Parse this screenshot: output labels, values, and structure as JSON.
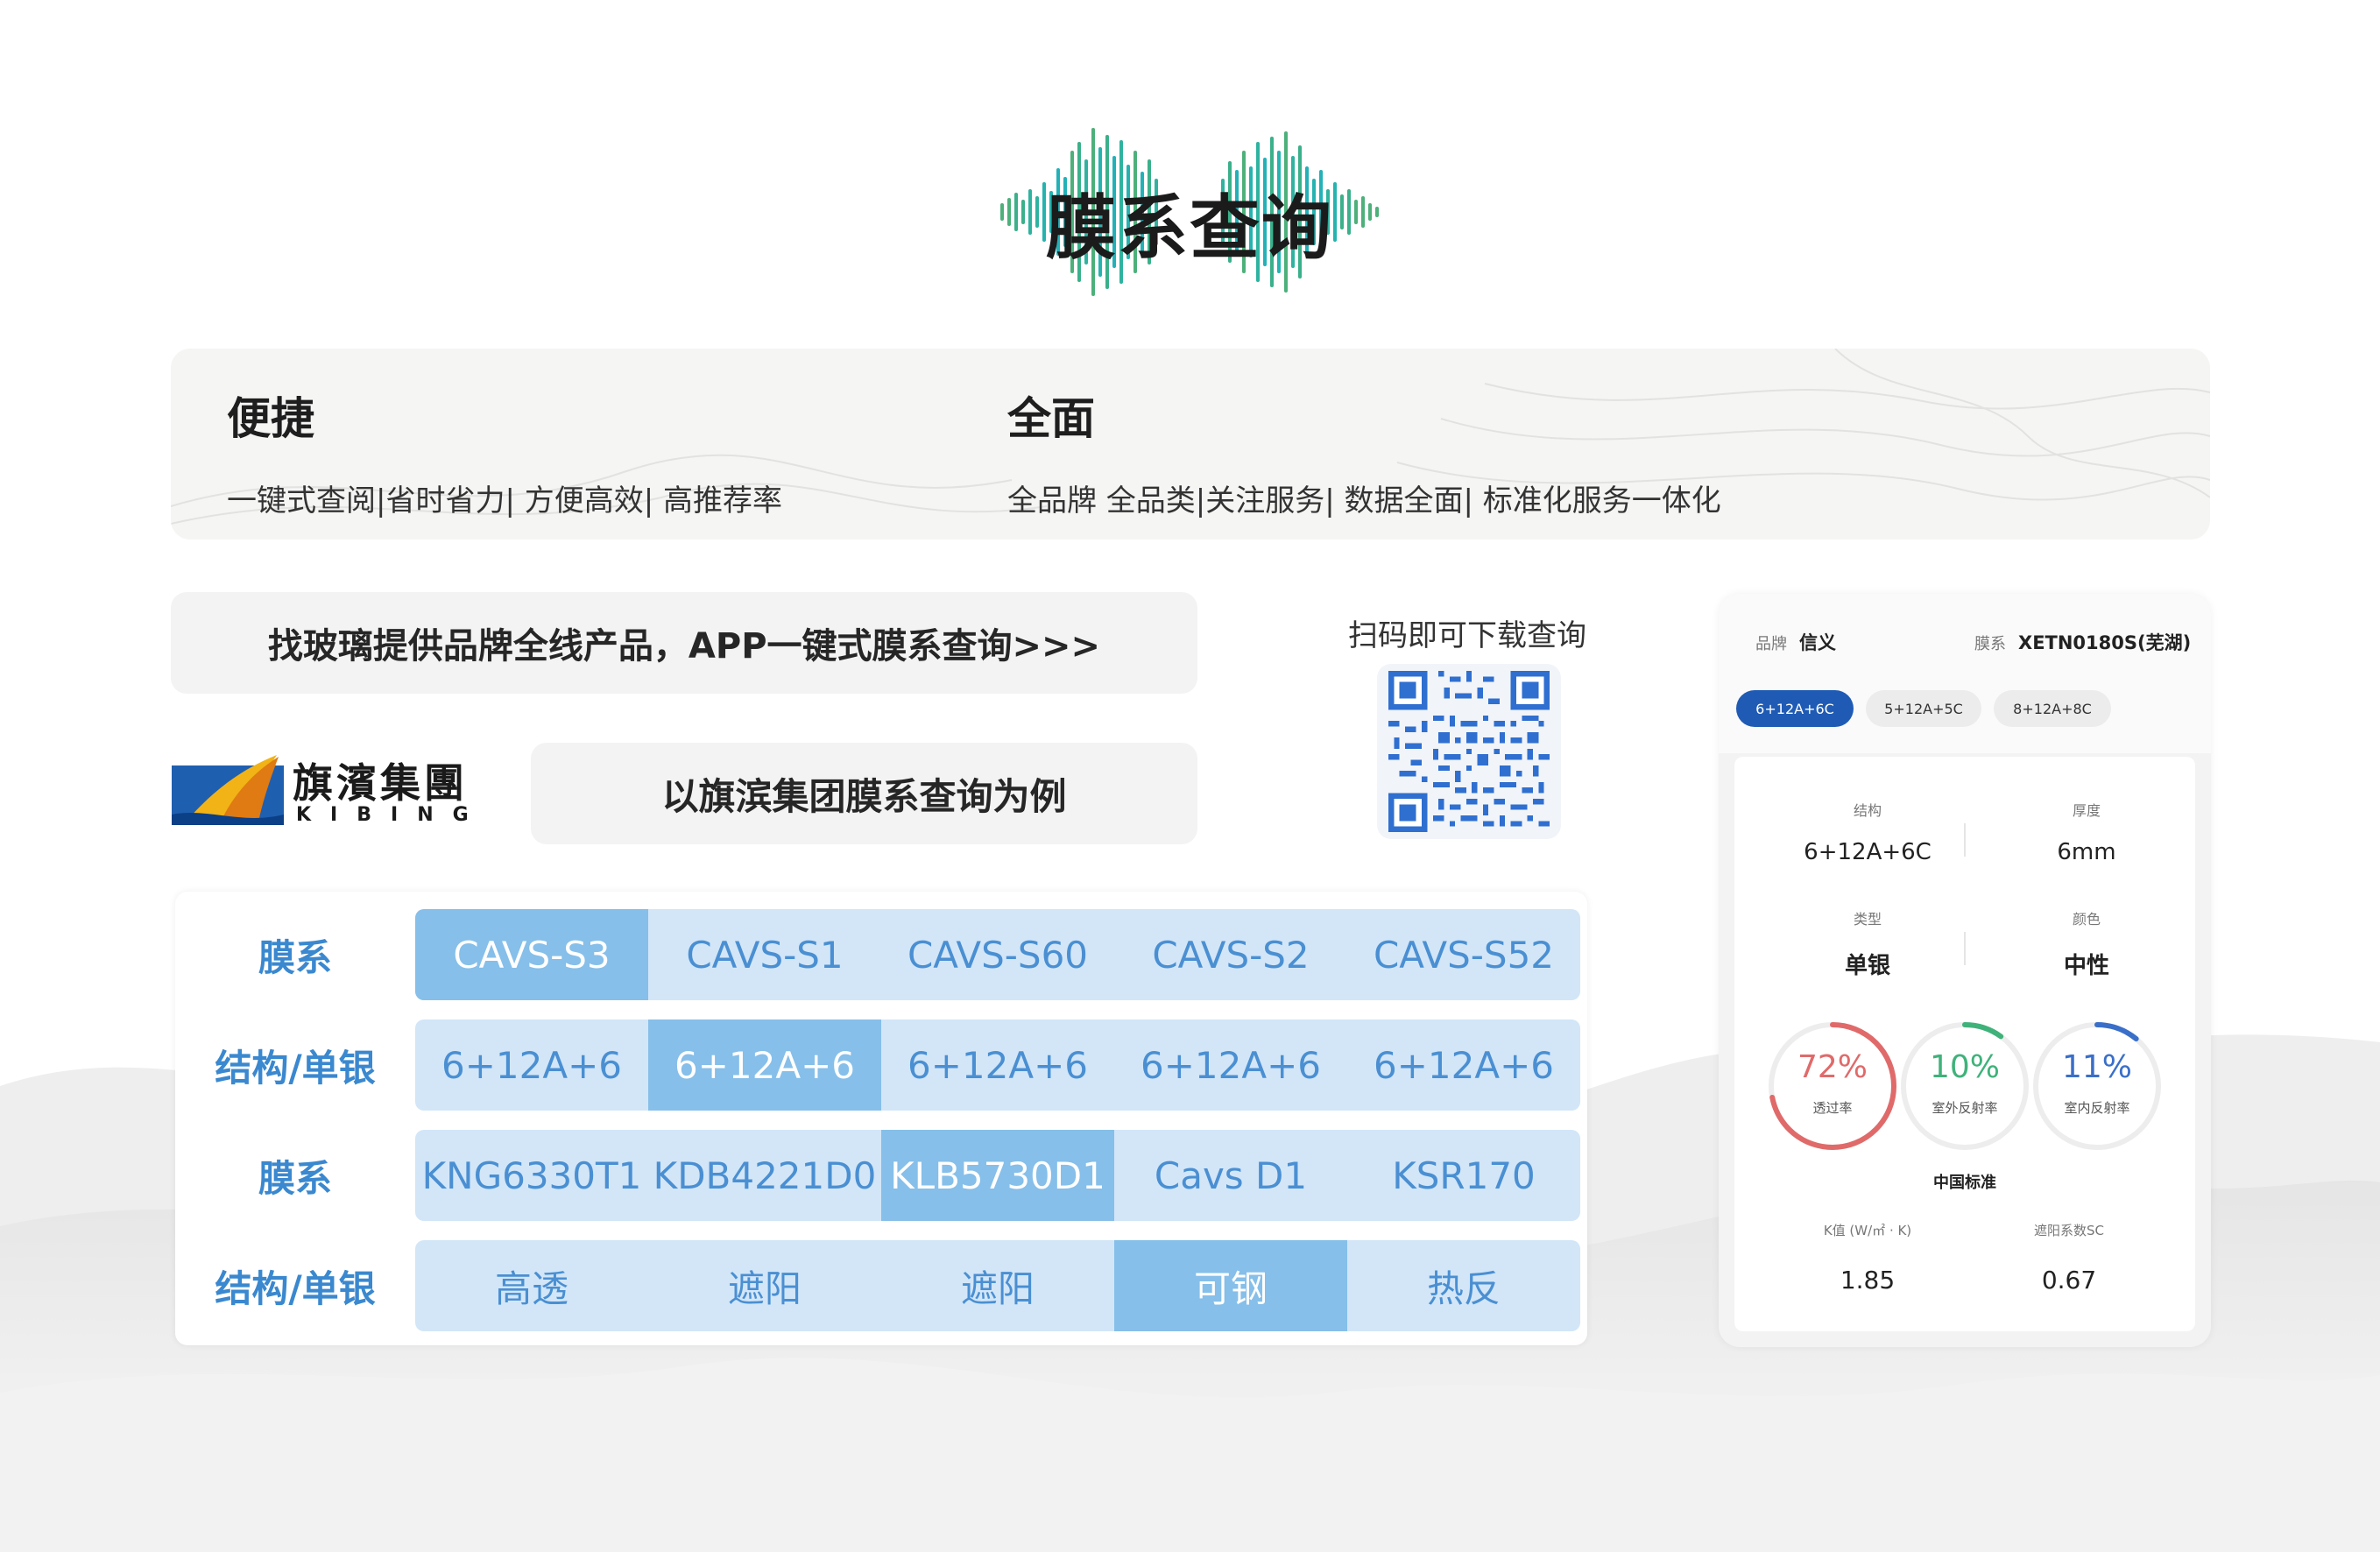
{
  "title": "膜系查询",
  "features": [
    {
      "title": "便捷",
      "desc": "一键式查阅|省时省力| 方便高效| 高推荐率"
    },
    {
      "title": "全面",
      "desc": "全品牌 全品类|关注服务| 数据全面| 标准化服务一体化"
    }
  ],
  "banner_main": "找玻璃提供品牌全线产品，APP一键式膜系查询>>>",
  "banner_example": "以旗滨集团膜系查询为例",
  "logo": {
    "cn": "旗濱集團",
    "en": "KIBING"
  },
  "qr": {
    "label": "扫码即可下载查询"
  },
  "table": {
    "rows": [
      {
        "label": "膜系",
        "cells": [
          "CAVS-S3",
          "CAVS-S1",
          "CAVS-S60",
          "CAVS-S2",
          "CAVS-S52"
        ]
      },
      {
        "label": "结构/单银",
        "cells": [
          "6+12A+6",
          "6+12A+6",
          "6+12A+6",
          "6+12A+6",
          "6+12A+6"
        ]
      },
      {
        "label": "膜系",
        "cells": [
          "KNG6330T1",
          "KDB4221D0",
          "KLB5730D1",
          "Cavs D1",
          "KSR170"
        ]
      },
      {
        "label": "结构/单银",
        "cells": [
          "高透",
          "遮阳",
          "遮阳",
          "可钢",
          "热反"
        ]
      }
    ]
  },
  "phone": {
    "brand_label": "品牌",
    "brand": "信义",
    "film_label": "膜系",
    "film": "XETN0180S(芜湖)",
    "tabs": [
      "6+12A+6C",
      "5+12A+5C",
      "8+12A+8C"
    ],
    "specs": [
      {
        "label": "结构",
        "value": "6+12A+6C"
      },
      {
        "label": "厚度",
        "value": "6mm"
      },
      {
        "label": "类型",
        "value": "单银"
      },
      {
        "label": "颜色",
        "value": "中性"
      }
    ],
    "rings": [
      {
        "pct": "72%",
        "label": "透过率",
        "color": "#e06a6a",
        "value": 72
      },
      {
        "pct": "10%",
        "label": "室外反射率",
        "color": "#3fb27a",
        "value": 10
      },
      {
        "pct": "11%",
        "label": "室内反射率",
        "color": "#3a6fc9",
        "value": 11
      }
    ],
    "standard": "中国标准",
    "k_label": "K值 (W/㎡ · K)",
    "k_value": "1.85",
    "sc_label": "遮阳系数SC",
    "sc_value": "0.67"
  }
}
